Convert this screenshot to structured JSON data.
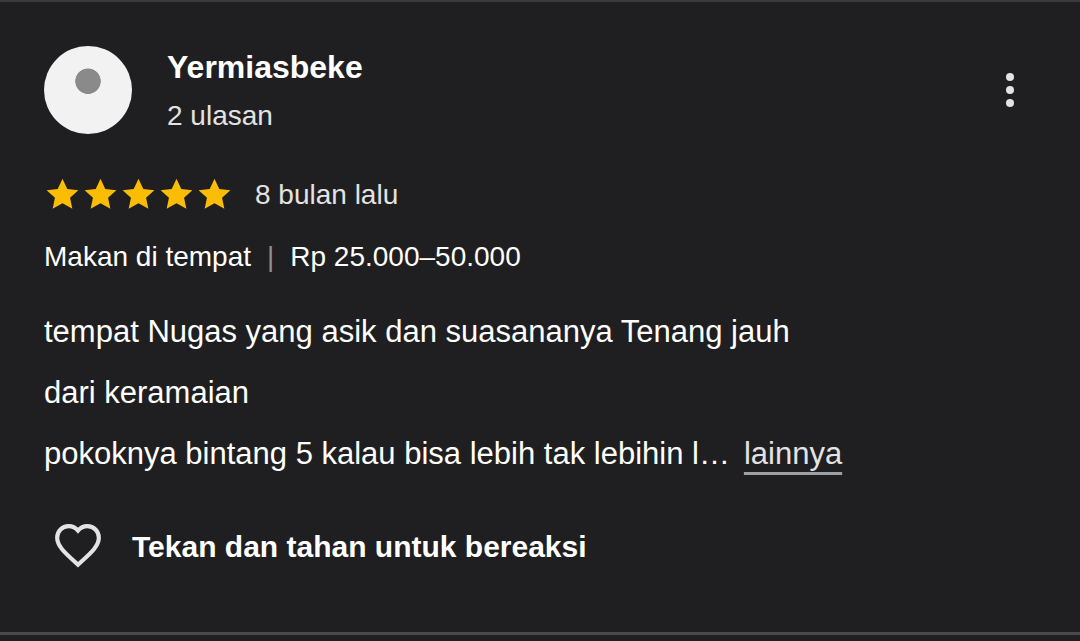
{
  "reviewer": {
    "name": "Yermiasbeke",
    "review_count": "2 ulasan"
  },
  "rating": {
    "stars": 5,
    "out_of": 5,
    "time": "8 bulan lalu"
  },
  "meta": {
    "items": [
      "Makan di tempat",
      "Rp 25.000–50.000"
    ],
    "separator": "|"
  },
  "review": {
    "lines": [
      "tempat Nugas yang asik dan suasananya Tenang jauh",
      "dari keramaian",
      "pokoknya bintang 5 kalau bisa lebih tak lebihin l…"
    ],
    "more": "lainnya"
  },
  "reaction": {
    "liked": false,
    "hint": "Tekan dan tahan untuk bereaksi"
  }
}
